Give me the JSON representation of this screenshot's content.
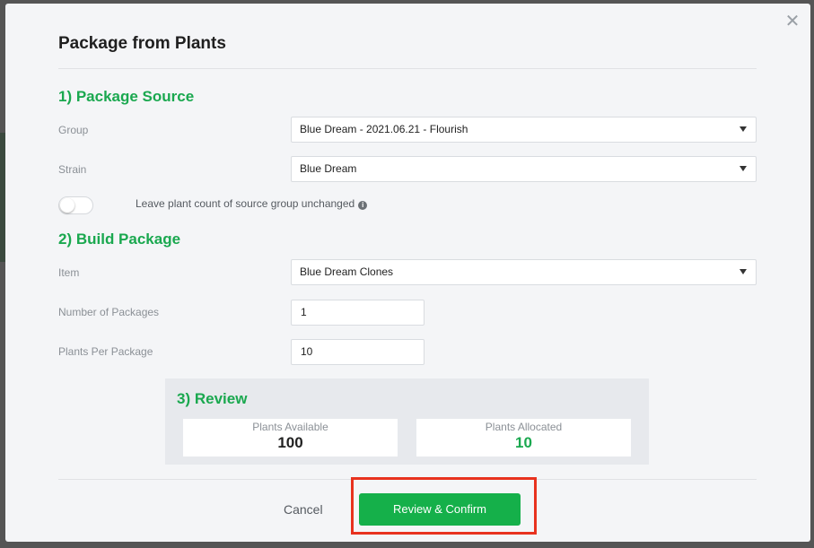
{
  "modal": {
    "title": "Package from Plants",
    "close_icon": "close-icon"
  },
  "package_source": {
    "heading": "1) Package Source",
    "group": {
      "label": "Group",
      "value": "Blue Dream - 2021.06.21 - Flourish"
    },
    "strain": {
      "label": "Strain",
      "value": "Blue Dream"
    },
    "toggle": {
      "label": "Leave plant count of source group unchanged",
      "on": false,
      "info_icon": "info-icon"
    }
  },
  "build_package": {
    "heading": "2) Build Package",
    "item": {
      "label": "Item",
      "value": "Blue Dream Clones"
    },
    "num_packages": {
      "label": "Number of Packages",
      "value": "1"
    },
    "plants_per_package": {
      "label": "Plants Per Package",
      "value": "10"
    }
  },
  "review": {
    "heading": "3) Review",
    "available": {
      "label": "Plants Available",
      "value": "100"
    },
    "allocated": {
      "label": "Plants Allocated",
      "value": "10"
    }
  },
  "footer": {
    "cancel_label": "Cancel",
    "confirm_label": "Review & Confirm"
  },
  "colors": {
    "accent_green": "#1aa84f",
    "button_green": "#15b04a",
    "highlight_red": "#e8321e",
    "value_dark": "#222222"
  }
}
